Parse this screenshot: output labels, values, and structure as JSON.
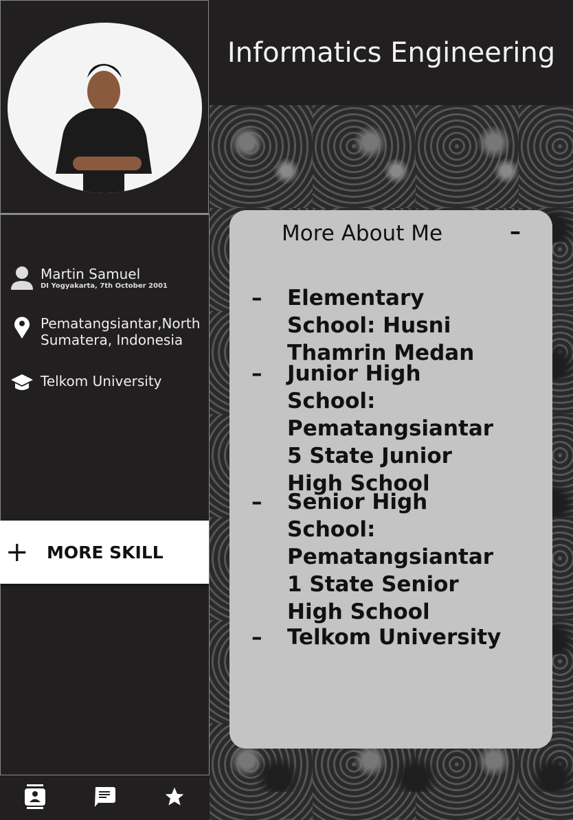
{
  "header": {
    "title": "Informatics Engineering"
  },
  "profile": {
    "name": "Martin Samuel",
    "birth": "DI Yogyakarta, 7th October 2001",
    "location": "Pematangsiantar,North Sumatera, Indonesia",
    "university": "Telkom University"
  },
  "skill_button": {
    "icon": "+",
    "label": "MORE SKILL"
  },
  "card": {
    "title": "More About Me",
    "collapse": "–",
    "items": [
      {
        "bullet": "–",
        "text": "Elementary School: Husni Thamrin Medan"
      },
      {
        "bullet": "–",
        "text": "Junior High School: Pematangsiantar 5 State Junior High School"
      },
      {
        "bullet": "–",
        "text": "Senior High School: Pematangsiantar 1 State Senior High School"
      },
      {
        "bullet": "–",
        "text": "Telkom University"
      }
    ]
  },
  "nav": [
    "contact-icon",
    "message-icon",
    "star-icon"
  ]
}
